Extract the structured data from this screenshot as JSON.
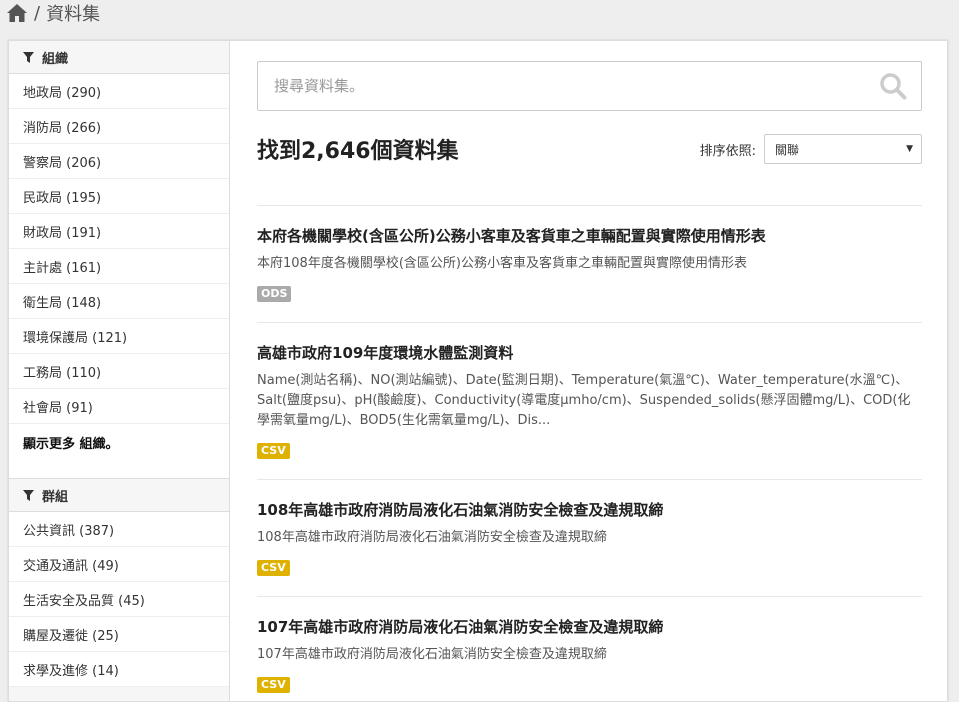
{
  "breadcrumb": {
    "separator": "/",
    "current": "資料集"
  },
  "sidebar": {
    "organizations": {
      "heading": "組織",
      "items": [
        {
          "label": "地政局 (290)"
        },
        {
          "label": "消防局 (266)"
        },
        {
          "label": "警察局 (206)"
        },
        {
          "label": "民政局 (195)"
        },
        {
          "label": "財政局 (191)"
        },
        {
          "label": "主計處 (161)"
        },
        {
          "label": "衛生局 (148)"
        },
        {
          "label": "環境保護局 (121)"
        },
        {
          "label": "工務局 (110)"
        },
        {
          "label": "社會局 (91)"
        }
      ],
      "show_more": "顯示更多 組織。"
    },
    "groups": {
      "heading": "群組",
      "items": [
        {
          "label": "公共資訊 (387)"
        },
        {
          "label": "交通及通訊 (49)"
        },
        {
          "label": "生活安全及品質 (45)"
        },
        {
          "label": "購屋及遷徙 (25)"
        },
        {
          "label": "求學及進修 (14)"
        }
      ]
    }
  },
  "search": {
    "placeholder": "搜尋資料集。"
  },
  "results": {
    "title": "找到2,646個資料集",
    "sort_label": "排序依照:",
    "sort_value": "關聯"
  },
  "datasets": [
    {
      "title": "本府各機關學校(含區公所)公務小客車及客貨車之車輛配置與實際使用情形表",
      "description": "本府108年度各機關學校(含區公所)公務小客車及客貨車之車輛配置與實際使用情形表",
      "format": "ODS",
      "format_color": "#aaaaaa"
    },
    {
      "title": "高雄市政府109年度環境水體監測資料",
      "description": "Name(測站名稱)、NO(測站編號)、Date(監測日期)、Temperature(氣溫℃)、Water_temperature(水溫℃)、Salt(鹽度psu)、pH(酸鹼度)、Conductivity(導電度µmho/cm)、Suspended_solids(懸浮固體mg/L)、COD(化學需氧量mg/L)、BOD5(生化需氧量mg/L)、Dis...",
      "format": "CSV",
      "format_color": "#dfb100"
    },
    {
      "title": "108年高雄市政府消防局液化石油氣消防安全檢查及違規取締",
      "description": "108年高雄市政府消防局液化石油氣消防安全檢查及違規取締",
      "format": "CSV",
      "format_color": "#dfb100"
    },
    {
      "title": "107年高雄市政府消防局液化石油氣消防安全檢查及違規取締",
      "description": "107年高雄市政府消防局液化石油氣消防安全檢查及違規取締",
      "format": "CSV",
      "format_color": "#dfb100"
    }
  ],
  "icons": {
    "home": "home-icon",
    "filter": "filter-icon",
    "search": "search-icon",
    "caret": "chevron-down-icon"
  },
  "colors": {
    "page_bg": "#eeeeee",
    "ods_badge": "#aaaaaa",
    "csv_badge": "#dfb100",
    "search_icon": "#cccccc"
  }
}
